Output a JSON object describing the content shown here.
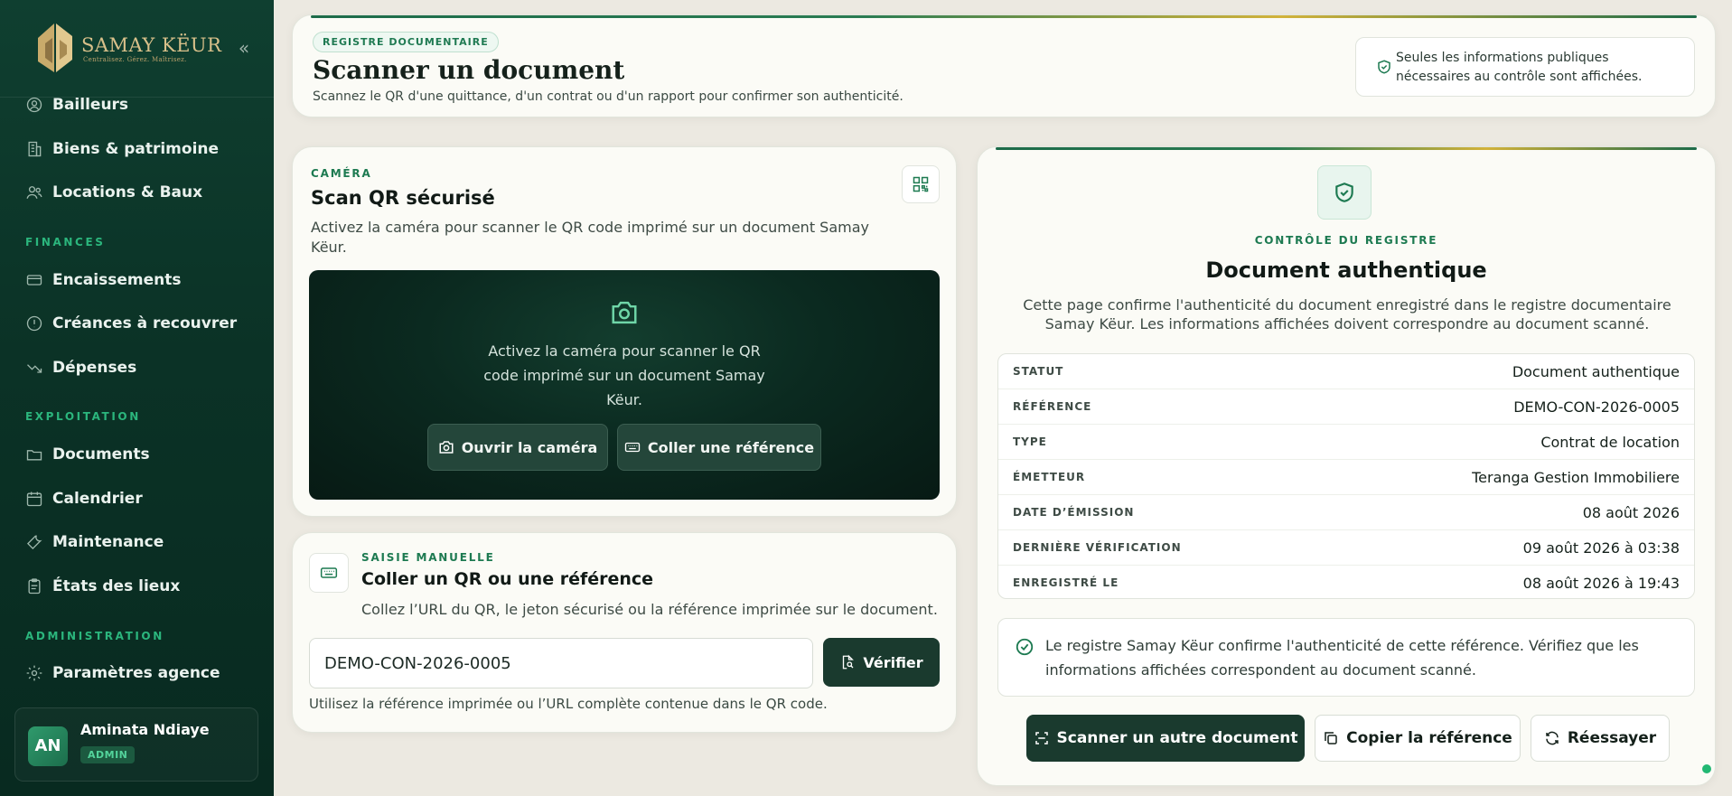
{
  "brand": {
    "name": "SAMAY KËUR",
    "tagline": "Centralisez. Gérez. Maîtrisez."
  },
  "sidebar": {
    "items_top": [
      {
        "label": "Bailleurs",
        "icon": "user-circle-icon"
      },
      {
        "label": "Biens & patrimoine",
        "icon": "building-icon"
      },
      {
        "label": "Locations & Baux",
        "icon": "users-icon"
      }
    ],
    "section_finances": "FINANCES",
    "items_finances": [
      {
        "label": "Encaissements",
        "icon": "credit-card-icon"
      },
      {
        "label": "Créances à recouvrer",
        "icon": "alert-circle-icon"
      },
      {
        "label": "Dépenses",
        "icon": "trend-down-icon"
      }
    ],
    "section_exploitation": "EXPLOITATION",
    "items_exploitation": [
      {
        "label": "Documents",
        "icon": "folder-icon"
      },
      {
        "label": "Calendrier",
        "icon": "calendar-icon"
      },
      {
        "label": "Maintenance",
        "icon": "wrench-icon"
      },
      {
        "label": "États des lieux",
        "icon": "clipboard-icon"
      }
    ],
    "section_administration": "ADMINISTRATION",
    "items_administration": [
      {
        "label": "Paramètres agence",
        "icon": "gear-icon"
      }
    ]
  },
  "user": {
    "initials": "AN",
    "name": "Aminata Ndiaye",
    "role": "ADMIN"
  },
  "header": {
    "badge": "REGISTRE DOCUMENTAIRE",
    "title": "Scanner un document",
    "subtitle": "Scannez le QR d'une quittance, d'un contrat ou d'un rapport pour confirmer son authenticité.",
    "notice": "Seules les informations publiques nécessaires au contrôle sont affichées."
  },
  "camera_card": {
    "eyebrow": "CAMÉRA",
    "title": "Scan QR sécurisé",
    "description": "Activez la caméra pour scanner le QR code imprimé sur un document Samay Këur.",
    "box_text": "Activez la caméra pour scanner le QR code imprimé sur un document Samay Këur.",
    "open_camera_label": "Ouvrir la caméra",
    "paste_reference_label": "Coller une référence"
  },
  "manual_card": {
    "eyebrow": "SAISIE MANUELLE",
    "title": "Coller un QR ou une référence",
    "description": "Collez l’URL du QR, le jeton sécurisé ou la référence imprimée sur le document.",
    "input_value": "DEMO-CON-2026-0005",
    "verify_label": "Vérifier",
    "hint": "Utilisez la référence imprimée ou l’URL complète contenue dans le QR code."
  },
  "result": {
    "eyebrow": "CONTRÔLE DU REGISTRE",
    "title": "Document authentique",
    "description": "Cette page confirme l'authenticité du document enregistré dans le registre documentaire Samay Këur. Les informations affichées doivent correspondre au document scanné.",
    "details": [
      {
        "key": "STATUT",
        "value": "Document authentique"
      },
      {
        "key": "RÉFÉRENCE",
        "value": "DEMO-CON-2026-0005"
      },
      {
        "key": "TYPE",
        "value": "Contrat de location"
      },
      {
        "key": "ÉMETTEUR",
        "value": "Teranga Gestion Immobiliere"
      },
      {
        "key": "DATE D’ÉMISSION",
        "value": "08 août 2026"
      },
      {
        "key": "DERNIÈRE VÉRIFICATION",
        "value": "09 août 2026 à 03:38"
      },
      {
        "key": "ENREGISTRÉ LE",
        "value": "08 août 2026 à 19:43"
      }
    ],
    "confirmation": "Le registre Samay Këur confirme l'authenticité de cette référence. Vérifiez que les informations affichées correspondent au document scanné.",
    "scan_another_label": "Scanner un autre document",
    "copy_reference_label": "Copier la référence",
    "retry_label": "Réessayer"
  },
  "colors": {
    "sidebar": "#0b3226",
    "accent": "#1d7a51",
    "primary_button": "#1a3a2e",
    "gold": "#d2b23a"
  }
}
